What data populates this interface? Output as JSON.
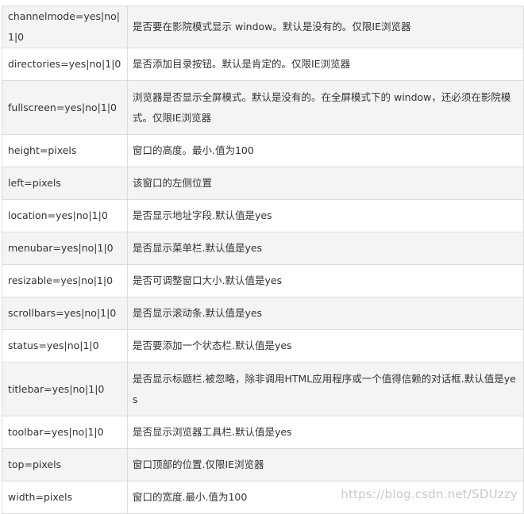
{
  "rows": [
    {
      "param": "channelmode=yes|no|1|0",
      "desc": "是否要在影院模式显示 window。默认是没有的。仅限IE浏览器"
    },
    {
      "param": "directories=yes|no|1|0",
      "desc": "是否添加目录按钮。默认是肯定的。仅限IE浏览器"
    },
    {
      "param": "fullscreen=yes|no|1|0",
      "desc": "浏览器是否显示全屏模式。默认是没有的。在全屏模式下的 window，还必须在影院模式。仅限IE浏览器"
    },
    {
      "param": "height=pixels",
      "desc": "窗口的高度。最小.值为100"
    },
    {
      "param": "left=pixels",
      "desc": "该窗口的左侧位置"
    },
    {
      "param": "location=yes|no|1|0",
      "desc": "是否显示地址字段.默认值是yes"
    },
    {
      "param": "menubar=yes|no|1|0",
      "desc": "是否显示菜单栏.默认值是yes"
    },
    {
      "param": "resizable=yes|no|1|0",
      "desc": "是否可调整窗口大小.默认值是yes"
    },
    {
      "param": "scrollbars=yes|no|1|0",
      "desc": "是否显示滚动条.默认值是yes"
    },
    {
      "param": "status=yes|no|1|0",
      "desc": "是否要添加一个状态栏.默认值是yes"
    },
    {
      "param": "titlebar=yes|no|1|0",
      "desc": "是否显示标题栏.被忽略，除非调用HTML应用程序或一个值得信赖的对话框.默认值是yes"
    },
    {
      "param": "toolbar=yes|no|1|0",
      "desc": "是否显示浏览器工具栏.默认值是yes"
    },
    {
      "param": "top=pixels",
      "desc": "窗口顶部的位置.仅限IE浏览器"
    },
    {
      "param": "width=pixels",
      "desc": "窗口的宽度.最小.值为100"
    }
  ],
  "watermark": "https://blog.csdn.net/SDUzzy"
}
